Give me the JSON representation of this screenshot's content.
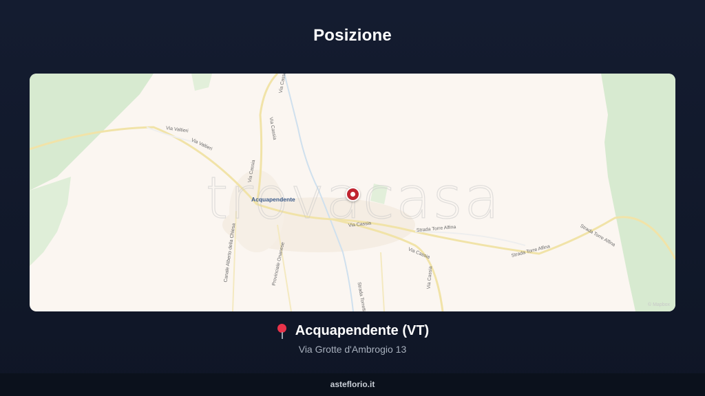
{
  "header": {
    "title": "Posizione"
  },
  "map": {
    "watermark": "trovacasa",
    "town_label": "Acquapendente",
    "road_labels": [
      "Via Cassia",
      "Via Cassia",
      "Via Cassia",
      "Via Cassia",
      "Via Valtieri",
      "Via Valtieri",
      "Strada Torre Alfina",
      "Strada Torre Alfina",
      "Strada Torre Alfina",
      "Strada Torretta",
      "Provinciale Onanese",
      "Canale Alberto della Chiesa",
      "Via Cassia",
      "Via Cassia"
    ],
    "attribution": "© Mapbox",
    "pin_icon": "map-marker-icon"
  },
  "location": {
    "icon": "pushpin-icon",
    "name": "Acquapendente (VT)",
    "address": "Via Grotte d'Ambrogio 13"
  },
  "footer": {
    "site": "asteflorio.it"
  },
  "colors": {
    "background": "#121a2c",
    "pin": "#c0242f",
    "park": "#d9ebd2",
    "road": "#f3e7b0"
  }
}
